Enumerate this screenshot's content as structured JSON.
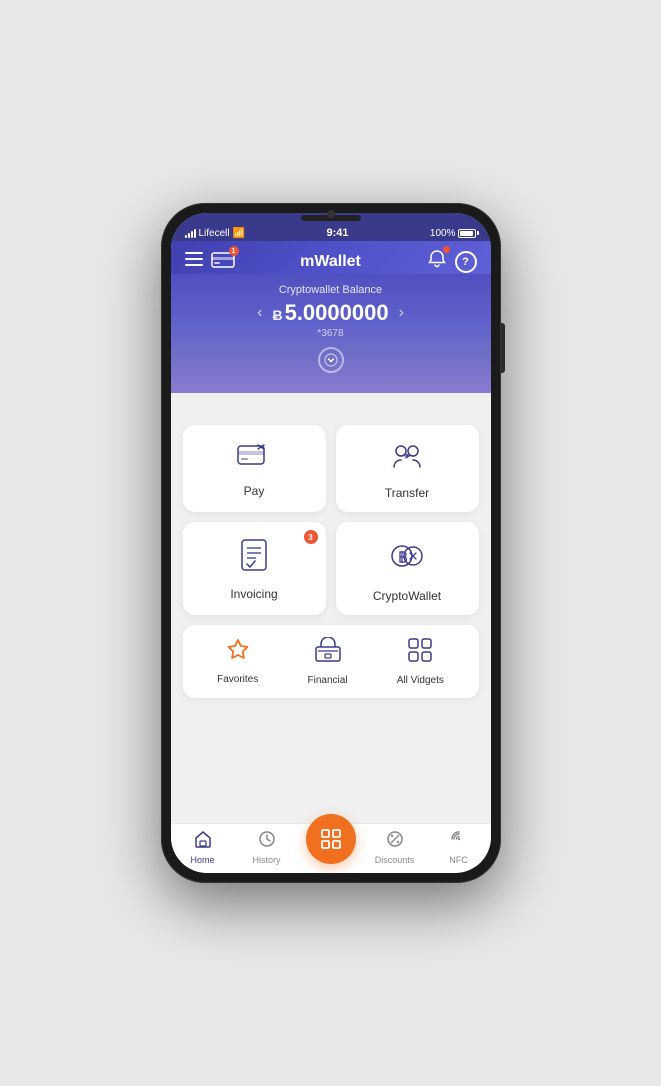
{
  "phone": {
    "status": {
      "carrier": "Lifecell",
      "wifi": true,
      "time": "9:41",
      "battery": "100%"
    }
  },
  "header": {
    "title": "mWallet",
    "card_badge": "1",
    "bell_has_notif": true
  },
  "balance": {
    "label": "Cryptowallet Balance",
    "symbol": "Ƀ",
    "amount": "5.0000000",
    "account": "*3678"
  },
  "actions": {
    "pay": {
      "label": "Pay"
    },
    "transfer": {
      "label": "Transfer"
    },
    "invoicing": {
      "label": "Invoicing",
      "badge": "3"
    },
    "cryptowallet": {
      "label": "CryptoWallet"
    }
  },
  "widgets": {
    "favorites": {
      "label": "Favorites"
    },
    "financial": {
      "label": "Financial"
    },
    "all_vidgets": {
      "label": "All Vidgets"
    }
  },
  "bottom_nav": {
    "home": {
      "label": "Home"
    },
    "history": {
      "label": "History"
    },
    "scan": {
      "label": ""
    },
    "discounts": {
      "label": "Discounts"
    },
    "nfc": {
      "label": "NFC"
    }
  }
}
